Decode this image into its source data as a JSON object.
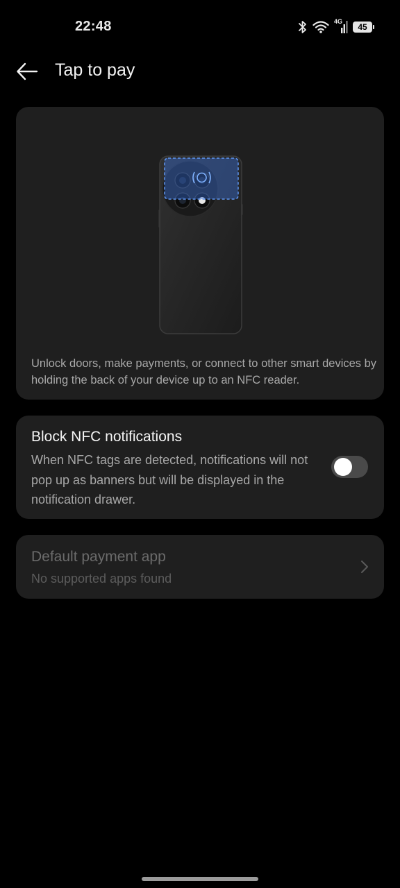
{
  "status_bar": {
    "time": "22:48",
    "network_label": "4G",
    "battery_level": "45",
    "icons": [
      "bluetooth-icon",
      "wifi-icon",
      "signal-icon",
      "battery-icon"
    ]
  },
  "header": {
    "title": "Tap to pay",
    "back_icon": "arrow-left-icon"
  },
  "illustration_card": {
    "description": "Unlock doors, make payments, or connect to other smart devices by holding the back of your device up to an NFC reader.",
    "nfc_badge": "N"
  },
  "block_nfc": {
    "title": "Block NFC notifications",
    "description": "When NFC tags are detected, notifications will not pop up as banners but will be displayed in the notification drawer.",
    "enabled": false
  },
  "default_payment": {
    "title": "Default payment app",
    "subtitle": "No supported apps found",
    "enabled": false
  },
  "colors": {
    "background": "#000000",
    "card": "#1f1f1f",
    "toggle_off": "#4a4a4a",
    "nfc_highlight": "#3a6fd8"
  }
}
